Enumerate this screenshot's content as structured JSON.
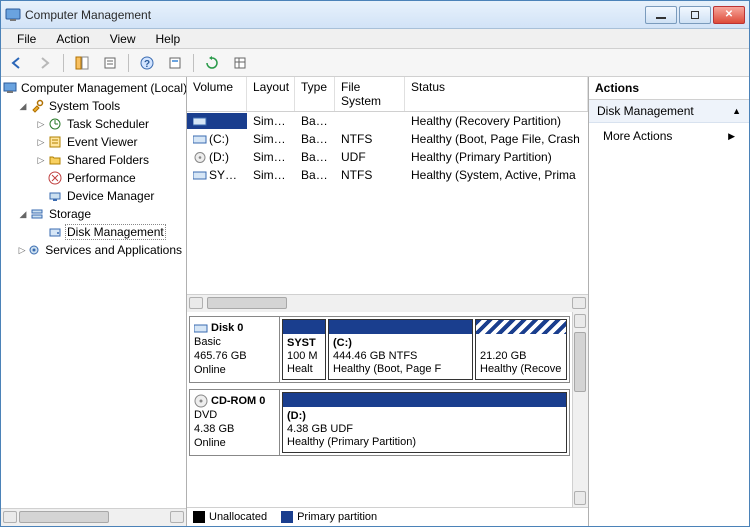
{
  "window": {
    "title": "Computer Management"
  },
  "menu": {
    "file": "File",
    "action": "Action",
    "view": "View",
    "help": "Help"
  },
  "tree": {
    "root": "Computer Management (Local)",
    "system_tools": "System Tools",
    "task_scheduler": "Task Scheduler",
    "event_viewer": "Event Viewer",
    "shared_folders": "Shared Folders",
    "performance": "Performance",
    "device_manager": "Device Manager",
    "storage": "Storage",
    "disk_management": "Disk Management",
    "services_apps": "Services and Applications"
  },
  "columns": {
    "volume": "Volume",
    "layout": "Layout",
    "type": "Type",
    "file_system": "File System",
    "status": "Status"
  },
  "volumes": [
    {
      "name": "",
      "layout": "Simple",
      "type": "Basic",
      "fs": "",
      "status": "Healthy (Recovery Partition)"
    },
    {
      "name": "(C:)",
      "layout": "Simple",
      "type": "Basic",
      "fs": "NTFS",
      "status": "Healthy (Boot, Page File, Crash"
    },
    {
      "name": "(D:)",
      "layout": "Simple",
      "type": "Basic",
      "fs": "UDF",
      "status": "Healthy (Primary Partition)"
    },
    {
      "name": "SYSTEM",
      "layout": "Simple",
      "type": "Basic",
      "fs": "NTFS",
      "status": "Healthy (System, Active, Prima"
    }
  ],
  "disks": {
    "d0": {
      "title": "Disk 0",
      "kind": "Basic",
      "size": "465.76 GB",
      "state": "Online",
      "parts": [
        {
          "name": "SYST",
          "info1": "100 M",
          "info2": "Healt"
        },
        {
          "name": "(C:)",
          "info1": "444.46 GB NTFS",
          "info2": "Healthy (Boot, Page F"
        },
        {
          "name": "",
          "info1": "21.20 GB",
          "info2": "Healthy (Recove"
        }
      ]
    },
    "cd0": {
      "title": "CD-ROM 0",
      "kind": "DVD",
      "size": "4.38 GB",
      "state": "Online",
      "parts": [
        {
          "name": "(D:)",
          "info1": "4.38 GB UDF",
          "info2": "Healthy (Primary Partition)"
        }
      ]
    }
  },
  "legend": {
    "unallocated": "Unallocated",
    "primary": "Primary partition"
  },
  "actions": {
    "header": "Actions",
    "disk_management": "Disk Management",
    "more_actions": "More Actions"
  }
}
